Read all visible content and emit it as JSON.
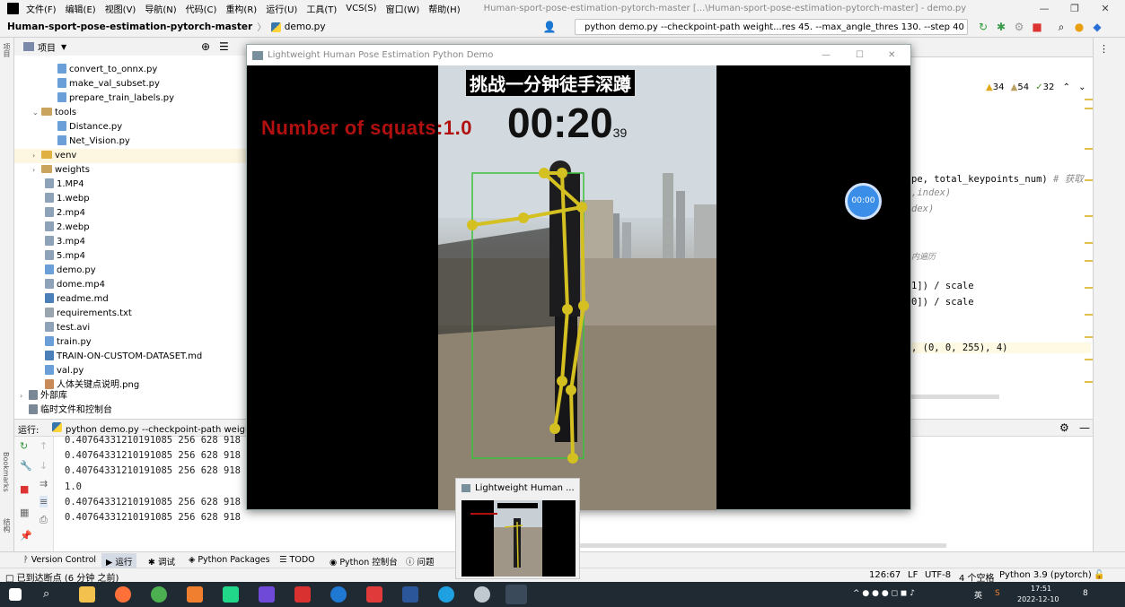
{
  "menubar": {
    "items": [
      "文件(F)",
      "编辑(E)",
      "视图(V)",
      "导航(N)",
      "代码(C)",
      "重构(R)",
      "运行(U)",
      "工具(T)",
      "VCS(S)",
      "窗口(W)",
      "帮助(H)"
    ],
    "window_title": "Human-sport-pose-estimation-pytorch-master [...\\Human-sport-pose-estimation-pytorch-master] - demo.py"
  },
  "navbar": {
    "project": "Human-sport-pose-estimation-pytorch-master",
    "file": "demo.py",
    "run_config": "python demo.py --checkpoint-path weight...res 45. --max_angle_thres 130. --step 40"
  },
  "side_tools": {
    "project": "项目",
    "bookmarks": "Bookmarks",
    "structure": "结构"
  },
  "project_panel": {
    "title": "项目",
    "items": [
      {
        "label": "convert_to_onnx.py",
        "type": "py"
      },
      {
        "label": "make_val_subset.py",
        "type": "py"
      },
      {
        "label": "prepare_train_labels.py",
        "type": "py"
      },
      {
        "label": "tools",
        "type": "folder-open"
      },
      {
        "label": "Distance.py",
        "type": "py"
      },
      {
        "label": "Net_Vision.py",
        "type": "py"
      },
      {
        "label": "venv",
        "type": "folder-closed"
      },
      {
        "label": "weights",
        "type": "folder-closed"
      },
      {
        "label": "1.MP4",
        "type": "file"
      },
      {
        "label": "1.webp",
        "type": "file"
      },
      {
        "label": "2.mp4",
        "type": "file"
      },
      {
        "label": "2.webp",
        "type": "file"
      },
      {
        "label": "3.mp4",
        "type": "file"
      },
      {
        "label": "5.mp4",
        "type": "file"
      },
      {
        "label": "demo.py",
        "type": "py"
      },
      {
        "label": "dome.mp4",
        "type": "file"
      },
      {
        "label": "readme.md",
        "type": "md"
      },
      {
        "label": "requirements.txt",
        "type": "txt"
      },
      {
        "label": "test.avi",
        "type": "file"
      },
      {
        "label": "train.py",
        "type": "py"
      },
      {
        "label": "TRAIN-ON-CUSTOM-DATASET.md",
        "type": "md"
      },
      {
        "label": "val.py",
        "type": "py"
      },
      {
        "label": "人体关键点说明.png",
        "type": "img"
      },
      {
        "label": "外部库",
        "type": "lib"
      },
      {
        "label": "临时文件和控制台",
        "type": "scratch"
      }
    ]
  },
  "editor": {
    "inspections": {
      "warnings": "34",
      "weak": "54",
      "typos": "32"
    },
    "lines": [
      {
        "text": "pe, total_keypoints_num)",
        "comment": "# 获取"
      },
      {
        "text": ",index)",
        "italic": true
      },
      {
        "text": "dex)",
        "italic": true
      },
      {
        "text": "内遍历",
        "italic": true
      },
      {
        "text": "1]) / scale"
      },
      {
        "text": "0]) / scale"
      },
      {
        "text": ", (0, 0, 255), 4)"
      }
    ]
  },
  "run_panel": {
    "label": "运行:",
    "tab": "python demo.py --checkpoint-path weight",
    "output": [
      "0.40764331210191085 256 628 918",
      "0.40764331210191085 256 628 918",
      "0.40764331210191085 256 628 918",
      "1.0",
      "0.40764331210191085 256 628 918",
      "0.40764331210191085 256 628 918"
    ]
  },
  "bottom_tools": [
    "Version Control",
    "运行",
    "调试",
    "Python Packages",
    "TODO",
    "Python 控制台",
    "问题"
  ],
  "status": {
    "left": "已到达断点 (6 分钟 之前)",
    "position": "126:67",
    "line_sep": "LF",
    "encoding": "UTF-8",
    "indent": "4 个空格",
    "interpreter": "Python 3.9 (pytorch)"
  },
  "demo_window": {
    "title": "Lightweight Human Pose Estimation Python Demo",
    "squat_text": "Number of squats:1.0",
    "chinese_title": "挑战一分钟徒手深蹲",
    "timer": "00:20",
    "timer_small": "39"
  },
  "float_button": "00:00",
  "thumbnail": {
    "title": "Lightweight Human ..."
  },
  "taskbar": {
    "time": "17:51",
    "date": "2022-12-10",
    "lang": "英",
    "notif": "8"
  },
  "colors": {
    "squat_text": "#b01010",
    "skeleton": "#d4c020",
    "bbox": "#3cc03c"
  }
}
